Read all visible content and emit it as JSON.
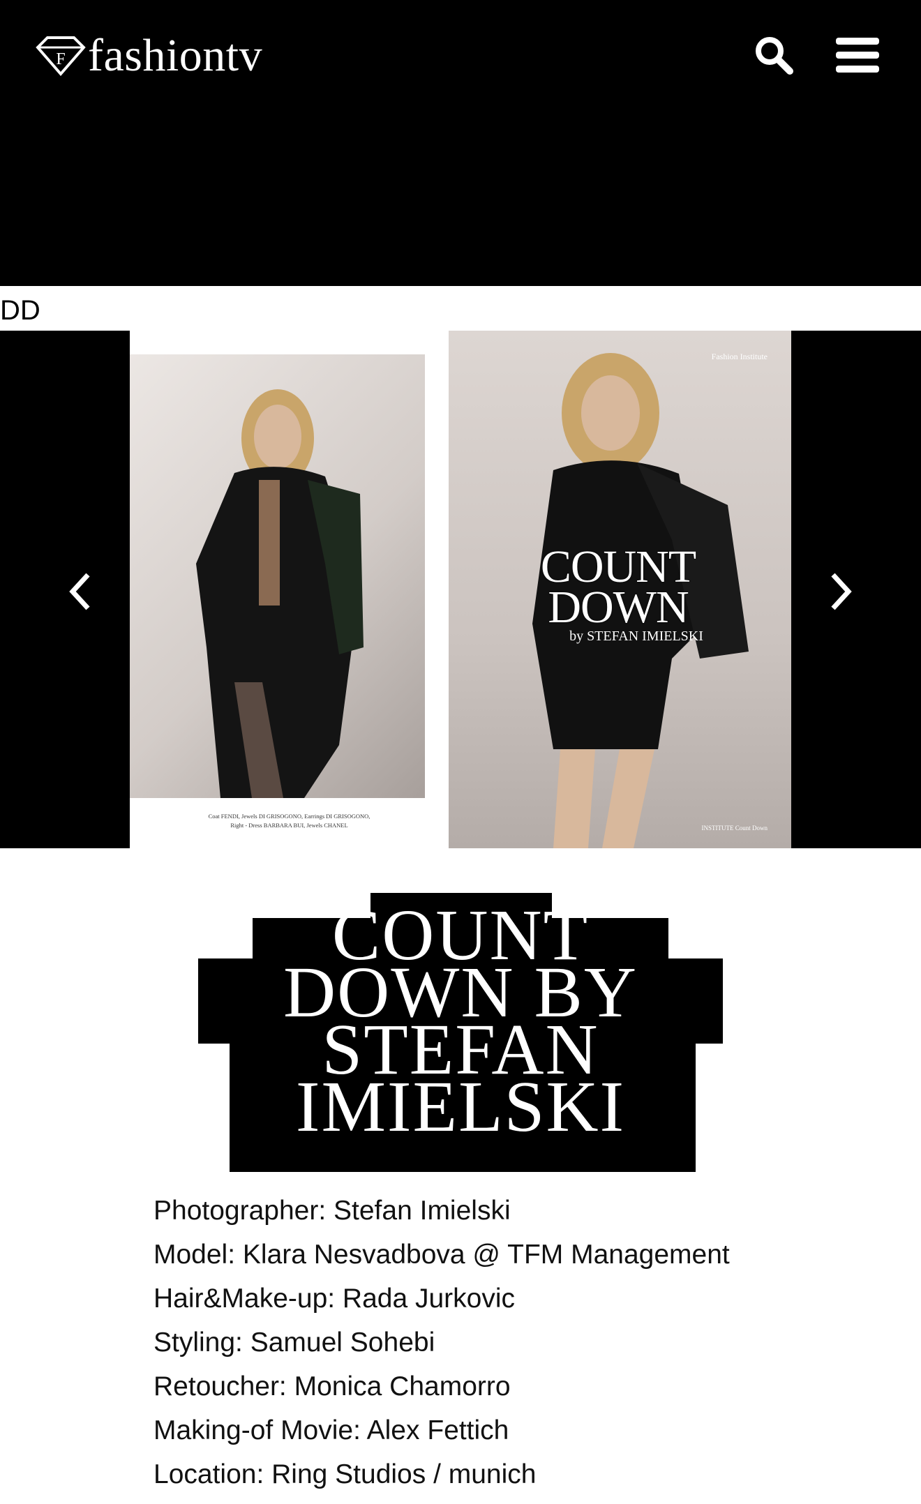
{
  "header": {
    "logo_mark": "F",
    "logo_text": "fashiontv",
    "search_icon": "search-icon",
    "menu_icon": "hamburger-menu-icon"
  },
  "stray_label": "DD",
  "gallery": {
    "prev_icon": "chevron-left-icon",
    "next_icon": "chevron-right-icon",
    "left_page": {
      "caption_line1": "Coat FENDI, Jewels DI GRISOGONO, Earrings DI GRISOGONO,",
      "caption_line2": "Right - Dress BARBARA BUI, Jewels CHANEL"
    },
    "right_page": {
      "tag": "Fashion Institute",
      "title_line1": "COUNT",
      "title_line2": "DOWN",
      "byline": "by STEFAN IMIELSKI",
      "footer": "INSTITUTE Count Down"
    }
  },
  "article": {
    "title_lines": [
      "COUNT",
      "DOWN BY",
      "STEFAN",
      "IMIELSKI"
    ],
    "credits": [
      "Photographer: Stefan Imielski",
      "Model: Klara Nesvadbova @ TFM Management",
      "Hair&Make-up: Rada Jurkovic",
      "Styling: Samuel Sohebi",
      "Retoucher: Monica Chamorro",
      "Making-of Movie: Alex Fettich",
      "Location: Ring Studios / munich"
    ]
  },
  "colors": {
    "header_bg": "#000000",
    "page_bg": "#ffffff",
    "text": "#111111"
  }
}
